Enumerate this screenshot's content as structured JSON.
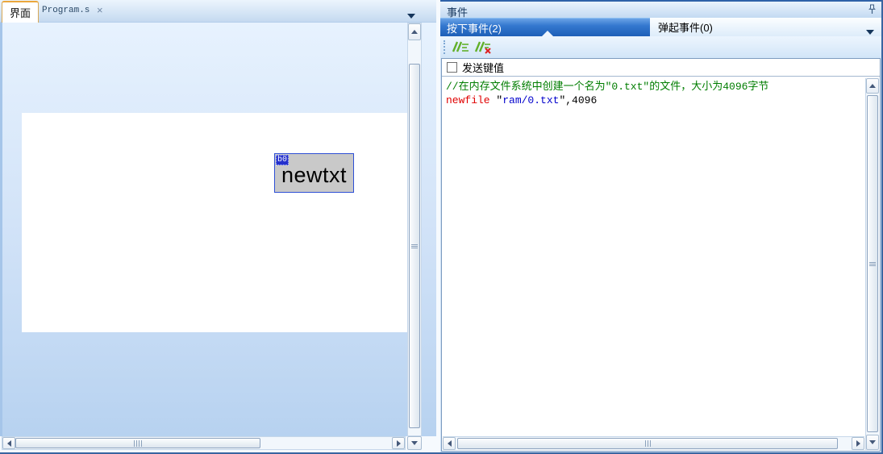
{
  "colors": {
    "accent_blue": "#1d5fb8",
    "selected_tab_top": "#6aa3e6",
    "active_tab_border": "#eba73c",
    "canvas_gradient_top": "#e7f2fe",
    "canvas_gradient_bottom": "#b7d2f0",
    "widget_fill": "#c9c9c9",
    "widget_border": "#2e4fd5",
    "widget_id_bg": "#2531cc",
    "code_comment": "#007d00",
    "code_keyword": "#e00000",
    "code_string": "#0000cc"
  },
  "icons": [
    "chevron-down-icon",
    "close-icon",
    "pushpin-icon",
    "add-comment-icon",
    "remove-comment-icon",
    "scroll-up-icon",
    "scroll-down-icon",
    "scroll-left-icon",
    "scroll-right-icon"
  ],
  "left_panel": {
    "tabs": [
      {
        "label": "界面",
        "active": true
      },
      {
        "label": "Program.s",
        "active": false
      }
    ],
    "close_icon": "×",
    "canvas_button": {
      "id": "b0",
      "label": "newtxt"
    }
  },
  "right_panel": {
    "title": "事件",
    "tabs": [
      {
        "label": "按下事件(2)",
        "selected": true
      },
      {
        "label": "弹起事件(0)",
        "selected": false
      }
    ],
    "checkbox": {
      "label": "发送键值",
      "checked": false
    },
    "code": {
      "lines": [
        {
          "type": "comment",
          "text": "//在内存文件系统中创建一个名为\"0.txt\"的文件，大小为4096字节"
        },
        {
          "type": "statement",
          "segments": [
            {
              "text": "newfile"
            },
            {
              "text": " \""
            },
            {
              "text": "ram/0.txt"
            },
            {
              "text": "\",4096"
            }
          ]
        }
      ]
    }
  }
}
